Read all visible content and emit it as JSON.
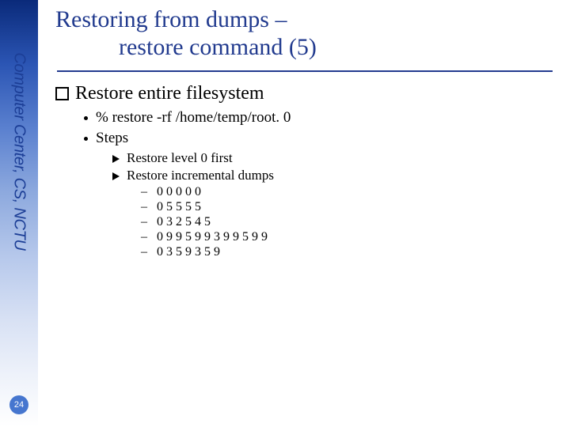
{
  "sidebar": {
    "org": "Computer Center, CS, NCTU"
  },
  "page": {
    "number": "24"
  },
  "title": {
    "line1": "Restoring from dumps –",
    "line2": "restore command (5)"
  },
  "main": {
    "heading": "Restore entire filesystem",
    "cmd": "% restore -rf  /home/temp/root. 0",
    "steps_label": "Steps",
    "steps": {
      "a": "Restore level 0 first",
      "b": "Restore incremental dumps"
    },
    "sequences": {
      "s1": "0 0 0 0 0",
      "s2": "0 5 5 5 5",
      "s3": "0 3 2 5 4 5",
      "s4": "0 9 9 5 9 9 3 9 9 5 9 9",
      "s5": "0 3 5 9 3 5 9"
    }
  }
}
